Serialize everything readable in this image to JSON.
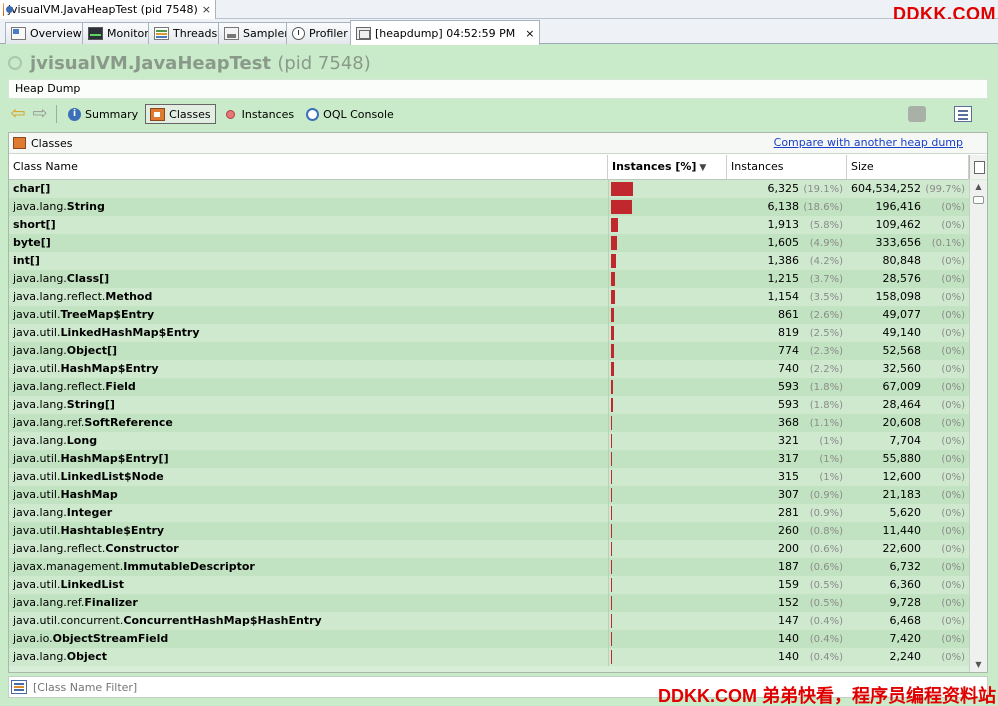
{
  "window": {
    "tab_title": "jvisualVM.JavaHeapTest (pid 7548)",
    "close_glyph": "×"
  },
  "watermarks": {
    "top": "DDKK.COM",
    "bottom": "DDKK.COM 弟弟快看，程序员编程资料站"
  },
  "tabs": [
    {
      "label": "Overview",
      "icon": "overview-icon"
    },
    {
      "label": "Monitor",
      "icon": "monitor-icon"
    },
    {
      "label": "Threads",
      "icon": "threads-icon"
    },
    {
      "label": "Sampler",
      "icon": "sampler-icon"
    },
    {
      "label": "Profiler",
      "icon": "profiler-icon"
    },
    {
      "label": "[heapdump] 04:52:59 PM",
      "icon": "heapdump-icon",
      "active": true
    }
  ],
  "header": {
    "app_name": "jvisualVM.JavaHeapTest",
    "pid": "(pid 7548)",
    "section": "Heap Dump"
  },
  "views": {
    "summary": "Summary",
    "classes": "Classes",
    "instances": "Instances",
    "oql": "OQL Console",
    "active": "classes"
  },
  "panel": {
    "title": "Classes",
    "compare_link": "Compare with another heap dump"
  },
  "table": {
    "columns": [
      "Class Name",
      "Instances [%]",
      "Instances",
      "Size"
    ],
    "sort_column": "Instances [%]",
    "rows": [
      {
        "pkg": "",
        "cls": "char[]",
        "pct": 19.1,
        "instances": "6,325",
        "inst_pct": "(19.1%)",
        "size": "604,534,252",
        "size_pct": "(99.7%)"
      },
      {
        "pkg": "java.lang.",
        "cls": "String",
        "pct": 18.6,
        "instances": "6,138",
        "inst_pct": "(18.6%)",
        "size": "196,416",
        "size_pct": "(0%)"
      },
      {
        "pkg": "",
        "cls": "short[]",
        "pct": 5.8,
        "instances": "1,913",
        "inst_pct": "(5.8%)",
        "size": "109,462",
        "size_pct": "(0%)"
      },
      {
        "pkg": "",
        "cls": "byte[]",
        "pct": 4.9,
        "instances": "1,605",
        "inst_pct": "(4.9%)",
        "size": "333,656",
        "size_pct": "(0.1%)"
      },
      {
        "pkg": "",
        "cls": "int[]",
        "pct": 4.2,
        "instances": "1,386",
        "inst_pct": "(4.2%)",
        "size": "80,848",
        "size_pct": "(0%)"
      },
      {
        "pkg": "java.lang.",
        "cls": "Class[]",
        "pct": 3.7,
        "instances": "1,215",
        "inst_pct": "(3.7%)",
        "size": "28,576",
        "size_pct": "(0%)"
      },
      {
        "pkg": "java.lang.reflect.",
        "cls": "Method",
        "pct": 3.5,
        "instances": "1,154",
        "inst_pct": "(3.5%)",
        "size": "158,098",
        "size_pct": "(0%)"
      },
      {
        "pkg": "java.util.",
        "cls": "TreeMap$Entry",
        "pct": 2.6,
        "instances": "861",
        "inst_pct": "(2.6%)",
        "size": "49,077",
        "size_pct": "(0%)"
      },
      {
        "pkg": "java.util.",
        "cls": "LinkedHashMap$Entry",
        "pct": 2.5,
        "instances": "819",
        "inst_pct": "(2.5%)",
        "size": "49,140",
        "size_pct": "(0%)"
      },
      {
        "pkg": "java.lang.",
        "cls": "Object[]",
        "pct": 2.3,
        "instances": "774",
        "inst_pct": "(2.3%)",
        "size": "52,568",
        "size_pct": "(0%)"
      },
      {
        "pkg": "java.util.",
        "cls": "HashMap$Entry",
        "pct": 2.2,
        "instances": "740",
        "inst_pct": "(2.2%)",
        "size": "32,560",
        "size_pct": "(0%)"
      },
      {
        "pkg": "java.lang.reflect.",
        "cls": "Field",
        "pct": 1.8,
        "instances": "593",
        "inst_pct": "(1.8%)",
        "size": "67,009",
        "size_pct": "(0%)"
      },
      {
        "pkg": "java.lang.",
        "cls": "String[]",
        "pct": 1.8,
        "instances": "593",
        "inst_pct": "(1.8%)",
        "size": "28,464",
        "size_pct": "(0%)"
      },
      {
        "pkg": "java.lang.ref.",
        "cls": "SoftReference",
        "pct": 1.1,
        "instances": "368",
        "inst_pct": "(1.1%)",
        "size": "20,608",
        "size_pct": "(0%)"
      },
      {
        "pkg": "java.lang.",
        "cls": "Long",
        "pct": 1.0,
        "instances": "321",
        "inst_pct": "(1%)",
        "size": "7,704",
        "size_pct": "(0%)"
      },
      {
        "pkg": "java.util.",
        "cls": "HashMap$Entry[]",
        "pct": 1.0,
        "instances": "317",
        "inst_pct": "(1%)",
        "size": "55,880",
        "size_pct": "(0%)"
      },
      {
        "pkg": "java.util.",
        "cls": "LinkedList$Node",
        "pct": 1.0,
        "instances": "315",
        "inst_pct": "(1%)",
        "size": "12,600",
        "size_pct": "(0%)"
      },
      {
        "pkg": "java.util.",
        "cls": "HashMap",
        "pct": 0.9,
        "instances": "307",
        "inst_pct": "(0.9%)",
        "size": "21,183",
        "size_pct": "(0%)"
      },
      {
        "pkg": "java.lang.",
        "cls": "Integer",
        "pct": 0.9,
        "instances": "281",
        "inst_pct": "(0.9%)",
        "size": "5,620",
        "size_pct": "(0%)"
      },
      {
        "pkg": "java.util.",
        "cls": "Hashtable$Entry",
        "pct": 0.8,
        "instances": "260",
        "inst_pct": "(0.8%)",
        "size": "11,440",
        "size_pct": "(0%)"
      },
      {
        "pkg": "java.lang.reflect.",
        "cls": "Constructor",
        "pct": 0.6,
        "instances": "200",
        "inst_pct": "(0.6%)",
        "size": "22,600",
        "size_pct": "(0%)"
      },
      {
        "pkg": "javax.management.",
        "cls": "ImmutableDescriptor",
        "pct": 0.6,
        "instances": "187",
        "inst_pct": "(0.6%)",
        "size": "6,732",
        "size_pct": "(0%)"
      },
      {
        "pkg": "java.util.",
        "cls": "LinkedList",
        "pct": 0.5,
        "instances": "159",
        "inst_pct": "(0.5%)",
        "size": "6,360",
        "size_pct": "(0%)"
      },
      {
        "pkg": "java.lang.ref.",
        "cls": "Finalizer",
        "pct": 0.5,
        "instances": "152",
        "inst_pct": "(0.5%)",
        "size": "9,728",
        "size_pct": "(0%)"
      },
      {
        "pkg": "java.util.concurrent.",
        "cls": "ConcurrentHashMap$HashEntry",
        "pct": 0.4,
        "instances": "147",
        "inst_pct": "(0.4%)",
        "size": "6,468",
        "size_pct": "(0%)"
      },
      {
        "pkg": "java.io.",
        "cls": "ObjectStreamField",
        "pct": 0.4,
        "instances": "140",
        "inst_pct": "(0.4%)",
        "size": "7,420",
        "size_pct": "(0%)"
      },
      {
        "pkg": "java.lang.",
        "cls": "Object",
        "pct": 0.4,
        "instances": "140",
        "inst_pct": "(0.4%)",
        "size": "2,240",
        "size_pct": "(0%)"
      }
    ]
  },
  "filter": {
    "placeholder": "[Class Name Filter]",
    "value": ""
  }
}
